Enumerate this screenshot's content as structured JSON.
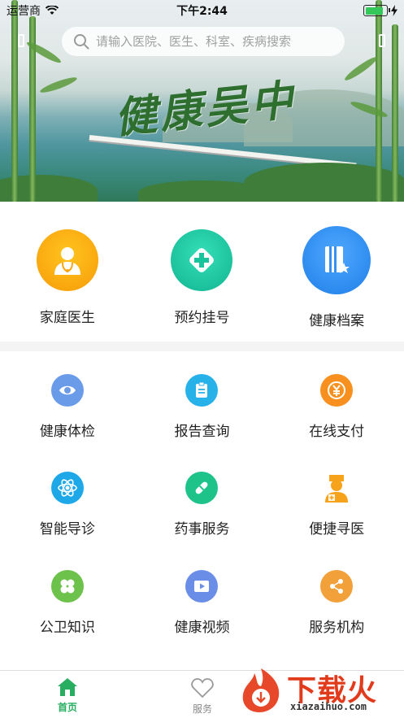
{
  "status_bar": {
    "carrier": "运营商",
    "time": "下午2:44",
    "battery_percent": 85
  },
  "search": {
    "placeholder": "请输入医院、医生、科室、疾病搜索"
  },
  "banner": {
    "calligraphy": "健康吴中"
  },
  "primary_services": [
    {
      "label": "家庭医生",
      "icon": "doctor-icon",
      "color": "#f9a512"
    },
    {
      "label": "预约挂号",
      "icon": "medical-cross-icon",
      "color": "#19c49d"
    },
    {
      "label": "健康档案",
      "icon": "health-record-icon",
      "color": "#3690f2"
    }
  ],
  "secondary_services": [
    {
      "label": "健康体检",
      "icon": "eye-icon",
      "color": "#6a9be8"
    },
    {
      "label": "报告查询",
      "icon": "clipboard-icon",
      "color": "#26b2e8"
    },
    {
      "label": "在线支付",
      "icon": "yen-icon",
      "color": "#f7901e"
    },
    {
      "label": "智能导诊",
      "icon": "atom-icon",
      "color": "#1ea8e8"
    },
    {
      "label": "药事服务",
      "icon": "pill-icon",
      "color": "#1ec38a"
    },
    {
      "label": "便捷寻医",
      "icon": "nurse-icon",
      "color": "#f7a21b"
    },
    {
      "label": "公卫知识",
      "icon": "clover-icon",
      "color": "#6cc24a"
    },
    {
      "label": "健康视频",
      "icon": "video-icon",
      "color": "#6a8ee8"
    },
    {
      "label": "服务机构",
      "icon": "share-icon",
      "color": "#f2a03a"
    }
  ],
  "tabs": [
    {
      "label": "首页",
      "icon": "home-icon",
      "active": true
    },
    {
      "label": "服务",
      "icon": "heart-icon",
      "active": false
    }
  ],
  "watermark": {
    "text": "下载火",
    "url": "xiazaihuo.com"
  }
}
